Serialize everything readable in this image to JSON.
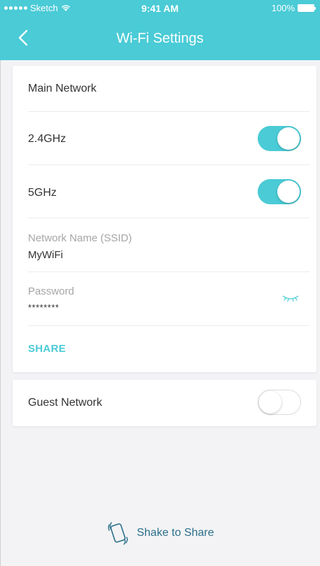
{
  "status_bar": {
    "carrier": "Sketch",
    "time": "9:41 AM",
    "battery": "100%"
  },
  "header": {
    "title": "Wi-Fi Settings",
    "back_icon": "chevron-left-icon"
  },
  "main_network": {
    "section_title": "Main Network",
    "band_24": {
      "label": "2.4GHz",
      "enabled": true
    },
    "band_5": {
      "label": "5GHz",
      "enabled": true
    },
    "ssid": {
      "label": "Network Name (SSID)",
      "value": "MyWiFi"
    },
    "password": {
      "label": "Password",
      "value": "********",
      "icon": "eye-closed-icon"
    },
    "share_label": "SHARE"
  },
  "guest_network": {
    "label": "Guest Network",
    "enabled": false
  },
  "shake": {
    "label": "Shake to Share",
    "icon": "shake-phone-icon"
  },
  "colors": {
    "accent": "#4acbd6",
    "shake_text": "#2b6f8a",
    "background": "#f3f3f5"
  }
}
